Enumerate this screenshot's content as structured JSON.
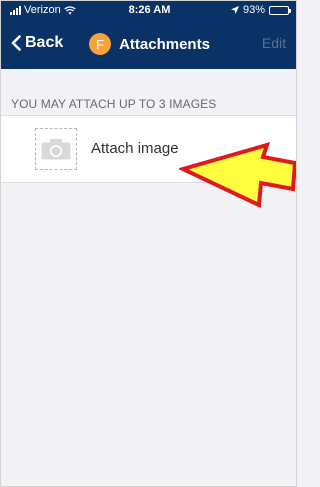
{
  "status_bar": {
    "carrier": "Verizon",
    "time": "8:26 AM",
    "battery": "93%"
  },
  "nav": {
    "back_label": "Back",
    "avatar_letter": "F",
    "title": "Attachments",
    "edit_label": "Edit"
  },
  "section": {
    "header": "YOU MAY ATTACH UP TO 3 IMAGES"
  },
  "attach": {
    "label": "Attach image",
    "icon": "camera-icon"
  },
  "colors": {
    "navbar_bg": "#0a3266",
    "avatar_bg": "#f7a23b",
    "arrow_fill": "#ffff40",
    "arrow_stroke": "#e01a1a"
  },
  "annotation": {
    "arrow_icon": "pointer-arrow-icon"
  }
}
